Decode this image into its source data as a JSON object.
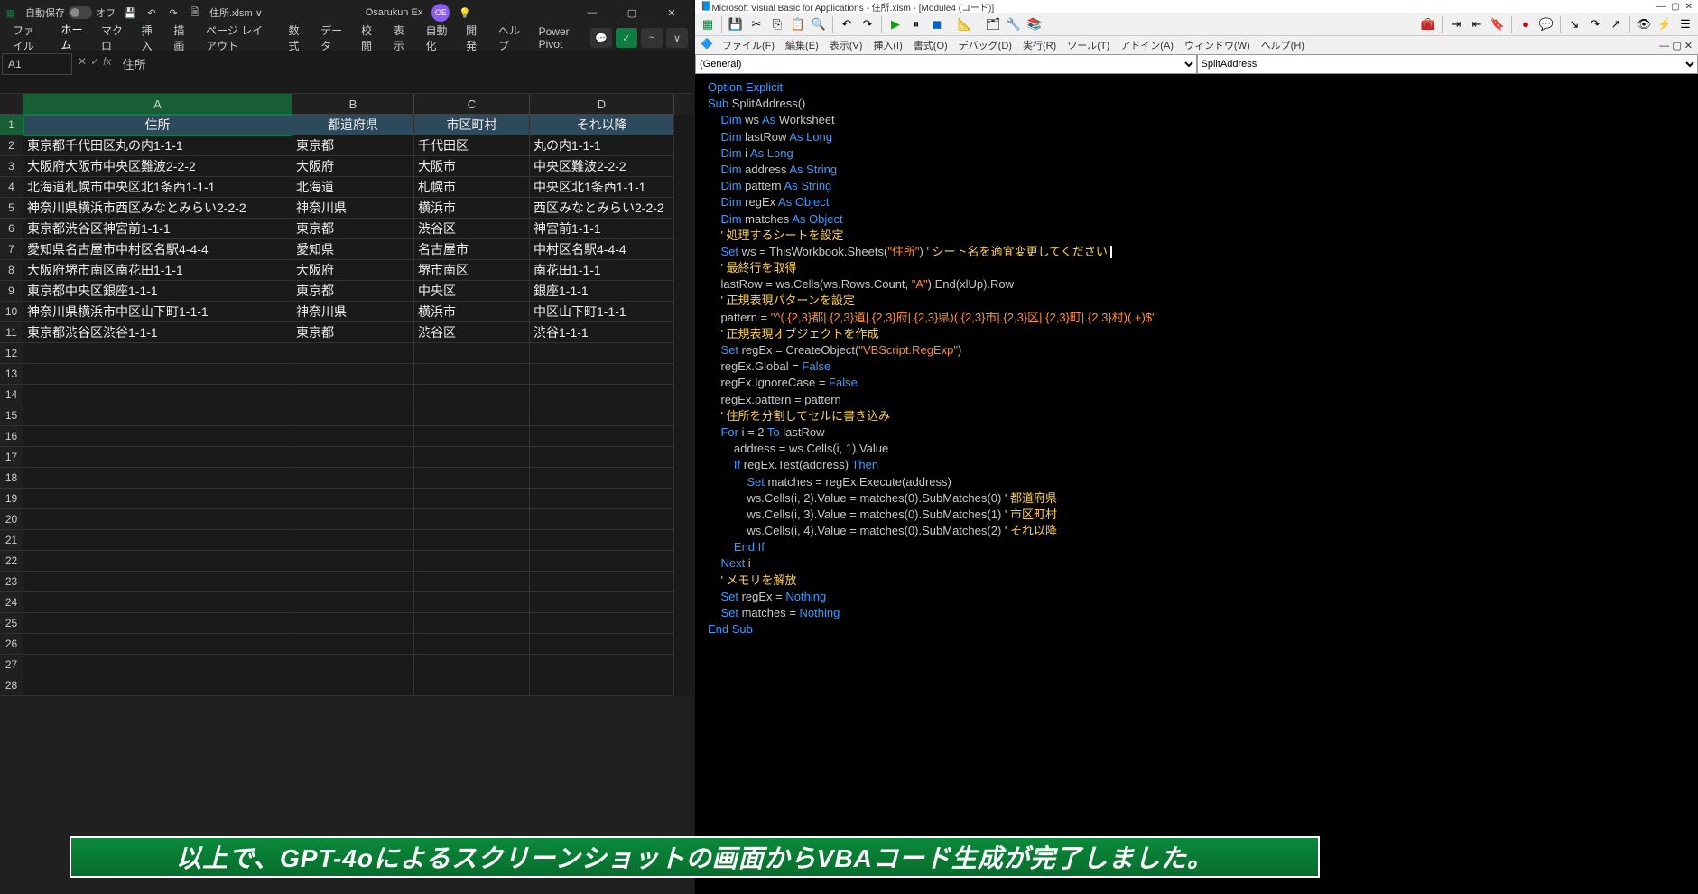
{
  "excel": {
    "titlebar": {
      "autosave_label": "自動保存",
      "autosave_state": "オフ",
      "filename": "住所.xlsm ∨",
      "search_label": "Osarukun Ex",
      "avatar": "OE"
    },
    "tabs": [
      "ファイル",
      "ホーム",
      "マクロ",
      "挿入",
      "描画",
      "ページ レイアウト",
      "数式",
      "データ",
      "校閲",
      "表示",
      "自動化",
      "開発",
      "ヘルプ",
      "Power Pivot"
    ],
    "active_tab": 1,
    "namebox": "A1",
    "formula": "住所",
    "cols": [
      "A",
      "B",
      "C",
      "D"
    ],
    "headers": [
      "住所",
      "都道府県",
      "市区町村",
      "それ以降"
    ],
    "data": [
      [
        "東京都千代田区丸の内1-1-1",
        "東京都",
        "千代田区",
        "丸の内1-1-1"
      ],
      [
        "大阪府大阪市中央区難波2-2-2",
        "大阪府",
        "大阪市",
        "中央区難波2-2-2"
      ],
      [
        "北海道札幌市中央区北1条西1-1-1",
        "北海道",
        "札幌市",
        "中央区北1条西1-1-1"
      ],
      [
        "神奈川県横浜市西区みなとみらい2-2-2",
        "神奈川県",
        "横浜市",
        "西区みなとみらい2-2-2"
      ],
      [
        "東京都渋谷区神宮前1-1-1",
        "東京都",
        "渋谷区",
        "神宮前1-1-1"
      ],
      [
        "愛知県名古屋市中村区名駅4-4-4",
        "愛知県",
        "名古屋市",
        "中村区名駅4-4-4"
      ],
      [
        "大阪府堺市南区南花田1-1-1",
        "大阪府",
        "堺市南区",
        "南花田1-1-1"
      ],
      [
        "東京都中央区銀座1-1-1",
        "東京都",
        "中央区",
        "銀座1-1-1"
      ],
      [
        "神奈川県横浜市中区山下町1-1-1",
        "神奈川県",
        "横浜市",
        "中区山下町1-1-1"
      ],
      [
        "東京都渋谷区渋谷1-1-1",
        "東京都",
        "渋谷区",
        "渋谷1-1-1"
      ]
    ],
    "total_rows": 28
  },
  "vbe": {
    "title": "Microsoft Visual Basic for Applications - 住所.xlsm - [Module4 (コード)]",
    "menus": [
      "ファイル(F)",
      "編集(E)",
      "表示(V)",
      "挿入(I)",
      "書式(O)",
      "デバッグ(D)",
      "実行(R)",
      "ツール(T)",
      "アドイン(A)",
      "ウィンドウ(W)",
      "ヘルプ(H)"
    ],
    "drop_left": "(General)",
    "drop_right": "SplitAddress",
    "code": [
      {
        "t": "Option Explicit",
        "c": [
          "kw",
          "kw"
        ]
      },
      {
        "t": ""
      },
      {
        "t": "Sub SplitAddress()",
        "p": [
          [
            "kw",
            "Sub "
          ],
          [
            "",
            "SplitAddress()"
          ]
        ]
      },
      {
        "t": "    Dim ws As Worksheet",
        "p": [
          [
            "kw",
            "    Dim "
          ],
          [
            "",
            "ws "
          ],
          [
            "kw",
            "As "
          ],
          [
            "",
            "Worksheet"
          ]
        ]
      },
      {
        "t": "    Dim lastRow As Long",
        "p": [
          [
            "kw",
            "    Dim "
          ],
          [
            "",
            "lastRow "
          ],
          [
            "kw",
            "As Long"
          ]
        ]
      },
      {
        "t": "    Dim i As Long",
        "p": [
          [
            "kw",
            "    Dim "
          ],
          [
            "",
            "i "
          ],
          [
            "kw",
            "As Long"
          ]
        ]
      },
      {
        "t": "    Dim address As String",
        "p": [
          [
            "kw",
            "    Dim "
          ],
          [
            "",
            "address "
          ],
          [
            "kw",
            "As String"
          ]
        ]
      },
      {
        "t": "    Dim pattern As String",
        "p": [
          [
            "kw",
            "    Dim "
          ],
          [
            "",
            "pattern "
          ],
          [
            "kw",
            "As String"
          ]
        ]
      },
      {
        "t": "    Dim regEx As Object",
        "p": [
          [
            "kw",
            "    Dim "
          ],
          [
            "",
            "regEx "
          ],
          [
            "kw",
            "As Object"
          ]
        ]
      },
      {
        "t": "    Dim matches As Object",
        "p": [
          [
            "kw",
            "    Dim "
          ],
          [
            "",
            "matches "
          ],
          [
            "kw",
            "As Object"
          ]
        ]
      },
      {
        "t": ""
      },
      {
        "t": "    ' 処理するシートを設定",
        "cmt": true
      },
      {
        "t": "    Set ws = ThisWorkbook.Sheets(\"住所\") ' シート名を適宜変更してください",
        "p": [
          [
            "kw",
            "    Set "
          ],
          [
            "",
            "ws = ThisWorkbook.Sheets("
          ],
          [
            "str",
            "\"住所\""
          ],
          [
            "",
            ") "
          ],
          [
            "cmt",
            "' シート名を適宜変更してください"
          ]
        ]
      },
      {
        "t": ""
      },
      {
        "t": "    ' 最終行を取得",
        "cmt": true
      },
      {
        "t": "    lastRow = ws.Cells(ws.Rows.Count, \"A\").End(xlUp).Row",
        "p": [
          [
            "",
            "    lastRow = ws.Cells(ws.Rows.Count, "
          ],
          [
            "str",
            "\"A\""
          ],
          [
            "",
            ").End(xlUp).Row"
          ]
        ]
      },
      {
        "t": ""
      },
      {
        "t": "    ' 正規表現パターンを設定",
        "cmt": true
      },
      {
        "t": "    pattern = \"^(.{2,3}都|.{2,3}道|.{2,3}府|.{2,3}県)(.{2,3}市|.{2,3}区|.{2,3}町|.{2,3}村)(.+)$\"",
        "p": [
          [
            "",
            "    pattern = "
          ],
          [
            "str",
            "\"^(.{2,3}都|.{2,3}道|.{2,3}府|.{2,3}県)(.{2,3}市|.{2,3}区|.{2,3}町|.{2,3}村)(.+)$\""
          ]
        ]
      },
      {
        "t": ""
      },
      {
        "t": "    ' 正規表現オブジェクトを作成",
        "cmt": true
      },
      {
        "t": "    Set regEx = CreateObject(\"VBScript.RegExp\")",
        "p": [
          [
            "kw",
            "    Set "
          ],
          [
            "",
            "regEx = CreateObject("
          ],
          [
            "str",
            "\"VBScript.RegExp\""
          ],
          [
            "",
            ")"
          ]
        ]
      },
      {
        "t": "    regEx.Global = False",
        "p": [
          [
            "",
            "    regEx.Global = "
          ],
          [
            "kw",
            "False"
          ]
        ]
      },
      {
        "t": "    regEx.IgnoreCase = False",
        "p": [
          [
            "",
            "    regEx.IgnoreCase = "
          ],
          [
            "kw",
            "False"
          ]
        ]
      },
      {
        "t": "    regEx.pattern = pattern"
      },
      {
        "t": ""
      },
      {
        "t": "    ' 住所を分割してセルに書き込み",
        "cmt": true
      },
      {
        "t": "    For i = 2 To lastRow",
        "p": [
          [
            "kw",
            "    For "
          ],
          [
            "",
            "i = "
          ],
          [
            "num",
            "2"
          ],
          [
            "kw",
            " To "
          ],
          [
            "",
            "lastRow"
          ]
        ]
      },
      {
        "t": "        address = ws.Cells(i, 1).Value",
        "p": [
          [
            "",
            "        address = ws.Cells(i, "
          ],
          [
            "num",
            "1"
          ],
          [
            "",
            ").Value"
          ]
        ]
      },
      {
        "t": "        If regEx.Test(address) Then",
        "p": [
          [
            "kw",
            "        If "
          ],
          [
            "",
            "regEx.Test(address) "
          ],
          [
            "kw",
            "Then"
          ]
        ]
      },
      {
        "t": "            Set matches = regEx.Execute(address)",
        "p": [
          [
            "kw",
            "            Set "
          ],
          [
            "",
            "matches = regEx.Execute(address)"
          ]
        ]
      },
      {
        "t": "            ws.Cells(i, 2).Value = matches(0).SubMatches(0) ' 都道府県",
        "p": [
          [
            "",
            "            ws.Cells(i, "
          ],
          [
            "num",
            "2"
          ],
          [
            "",
            ").Value = matches("
          ],
          [
            "num",
            "0"
          ],
          [
            "",
            ").SubMatches("
          ],
          [
            "num",
            "0"
          ],
          [
            "",
            ") "
          ],
          [
            "cmt",
            "' 都道府県"
          ]
        ]
      },
      {
        "t": "            ws.Cells(i, 3).Value = matches(0).SubMatches(1) ' 市区町村",
        "p": [
          [
            "",
            "            ws.Cells(i, "
          ],
          [
            "num",
            "3"
          ],
          [
            "",
            ").Value = matches("
          ],
          [
            "num",
            "0"
          ],
          [
            "",
            ").SubMatches("
          ],
          [
            "num",
            "1"
          ],
          [
            "",
            ") "
          ],
          [
            "cmt",
            "' 市区町村"
          ]
        ]
      },
      {
        "t": "            ws.Cells(i, 4).Value = matches(0).SubMatches(2) ' それ以降",
        "p": [
          [
            "",
            "            ws.Cells(i, "
          ],
          [
            "num",
            "4"
          ],
          [
            "",
            ").Value = matches("
          ],
          [
            "num",
            "0"
          ],
          [
            "",
            ").SubMatches("
          ],
          [
            "num",
            "2"
          ],
          [
            "",
            ") "
          ],
          [
            "cmt",
            "' それ以降"
          ]
        ]
      },
      {
        "t": "        End If",
        "p": [
          [
            "kw",
            "        End If"
          ]
        ]
      },
      {
        "t": "    Next i",
        "p": [
          [
            "kw",
            "    Next "
          ],
          [
            "",
            "i"
          ]
        ]
      },
      {
        "t": ""
      },
      {
        "t": "    ' メモリを解放",
        "cmt": true
      },
      {
        "t": "    Set regEx = Nothing",
        "p": [
          [
            "kw",
            "    Set "
          ],
          [
            "",
            "regEx = "
          ],
          [
            "kw",
            "Nothing"
          ]
        ]
      },
      {
        "t": "    Set matches = Nothing",
        "p": [
          [
            "kw",
            "    Set "
          ],
          [
            "",
            "matches = "
          ],
          [
            "kw",
            "Nothing"
          ]
        ]
      },
      {
        "t": "End Sub",
        "p": [
          [
            "kw",
            "End Sub"
          ]
        ]
      }
    ]
  },
  "banner": "以上で、GPT-4oによるスクリーンショットの画面からVBAコード生成が完了しました。"
}
